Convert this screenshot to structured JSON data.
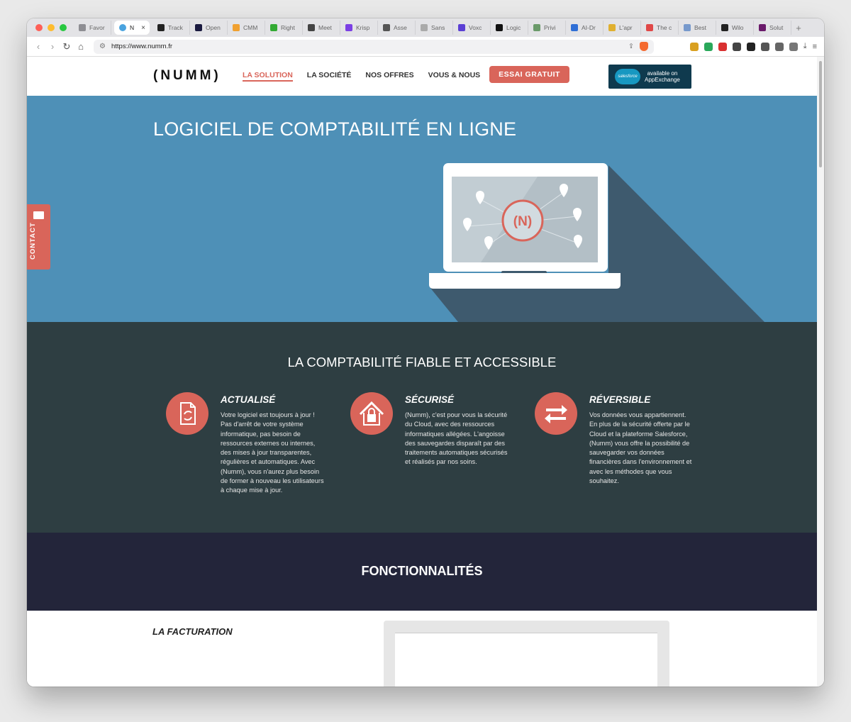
{
  "browser": {
    "tabs": [
      {
        "label": "Favor",
        "color": "#8e8e93"
      },
      {
        "label": "N",
        "color": "#4aa3df",
        "active": true
      },
      {
        "label": "Track",
        "color": "#222222"
      },
      {
        "label": "Open",
        "color": "#1a1a40"
      },
      {
        "label": "CMM",
        "color": "#f0a030"
      },
      {
        "label": "Right",
        "color": "#33aa33"
      },
      {
        "label": "Meet",
        "color": "#444444"
      },
      {
        "label": "Krisp",
        "color": "#7b3fe4"
      },
      {
        "label": "Asse",
        "color": "#555555"
      },
      {
        "label": "Sans",
        "color": "#aaaaaa"
      },
      {
        "label": "Voxc",
        "color": "#5b3fd4"
      },
      {
        "label": "Logic",
        "color": "#111111"
      },
      {
        "label": "Privi",
        "color": "#6a9a6a"
      },
      {
        "label": "AI-Dr",
        "color": "#2f6fd6"
      },
      {
        "label": "L'apr",
        "color": "#e0b030"
      },
      {
        "label": "The c",
        "color": "#e04848"
      },
      {
        "label": "Best",
        "color": "#7799cc"
      },
      {
        "label": "Wilo",
        "color": "#222222"
      },
      {
        "label": "Solut",
        "color": "#6a1a6a"
      }
    ],
    "new_tab_label": "+",
    "active_tab_close": "×",
    "url": "https://www.numm.fr",
    "extension_colors": [
      "#d9a020",
      "#2aa85a",
      "#d93030",
      "#444444",
      "#222222",
      "#555555",
      "#666666",
      "#777777"
    ]
  },
  "site": {
    "logo": "(NUMM)",
    "nav": [
      "LA SOLUTION",
      "LA SOCIÉTÉ",
      "NOS OFFRES",
      "VOUS & NOUS"
    ],
    "cta": "ESSAI GRATUIT",
    "badge": {
      "brand": "salesforce",
      "line1": "available on",
      "line2": "AppExchange"
    },
    "contact": "CONTACT",
    "hero_title": "LOGICIEL DE COMPTABILITÉ EN LIGNE",
    "hero_logo": "(N)",
    "features_title": "LA COMPTABILITÉ FIABLE ET ACCESSIBLE",
    "features": [
      {
        "title": "ACTUALISÉ",
        "icon": "document-sync-icon",
        "desc": "Votre logiciel est toujours à jour ! Pas d'arrêt de votre système informatique, pas besoin de ressources externes ou internes, des mises à jour transparentes, régulières et automatiques. Avec (Numm), vous n'aurez plus besoin de former à nouveau les utilisateurs à chaque mise à jour."
      },
      {
        "title": "SÉCURISÉ",
        "icon": "secure-house-lock-icon",
        "desc": "(Numm), c'est pour vous la sécurité du Cloud, avec des ressources informatiques allégées. L'angoisse des sauvegardes disparaît par des traitements automatiques sécurisés et réalisés par nos soins."
      },
      {
        "title": "RÉVERSIBLE",
        "icon": "swap-arrows-icon",
        "desc": "Vos données vous appartiennent. En plus de la sécurité offerte par le Cloud et la plateforme Salesforce, (Numm) vous offre la possibilité de sauvegarder vos données financières dans l'environnement et avec les méthodes que vous souhaitez."
      }
    ],
    "functions_title": "FONCTIONNALITÉS",
    "billing_title": "LA FACTURATION"
  },
  "colors": {
    "accent": "#d9655a",
    "hero_bg": "#4e90b7",
    "features_bg": "#2e3e42",
    "functions_bg": "#23253a"
  }
}
